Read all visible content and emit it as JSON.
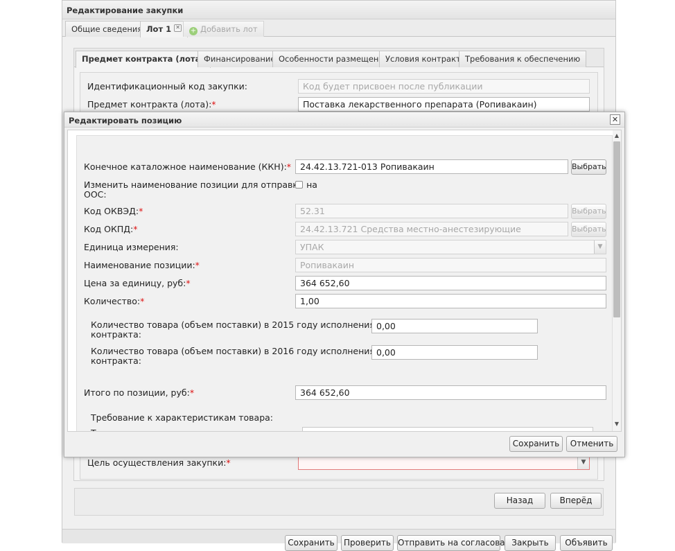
{
  "outer": {
    "title": "Редактирование закупки",
    "tabs": [
      {
        "label": "Общие сведения"
      },
      {
        "label": "Лот 1"
      },
      {
        "label": "Добавить лот"
      }
    ],
    "inner_tabs": [
      {
        "label": "Предмет контракта (лота)"
      },
      {
        "label": "Финансирование"
      },
      {
        "label": "Особенности размещения"
      },
      {
        "label": "Условия контракта"
      },
      {
        "label": "Требования к обеспечению"
      }
    ],
    "fields": {
      "id_code_label": "Идентификационный код закупки:",
      "id_code_value": "Код будет присвоен после публикации",
      "subject_label": "Предмет контракта (лота):",
      "subject_value": "Поставка лекарственного препарата (Ропивакаин)",
      "purpose_label": "Цель осуществления закупки:",
      "purpose_value": ""
    },
    "nav_buttons": {
      "back": "Назад",
      "forward": "Вперёд"
    },
    "bottom_buttons": [
      "Сохранить",
      "Проверить",
      "Отправить на согласование",
      "Закрыть",
      "Объявить"
    ]
  },
  "modal": {
    "title": "Редактировать позицию",
    "close_icon": "close-icon",
    "fields": {
      "kkn_label": "Конечное каталожное наименование (ККН):",
      "kkn_value": "24.42.13.721-013 Ропивакаин",
      "kkn_button": "Выбрать",
      "rename_label_line1": "Изменить наименование позиции для отправки на",
      "rename_label_line2": "ООС:",
      "okved_label": "Код ОКВЭД:",
      "okved_value": "52.31",
      "okved_button": "Выбрать",
      "okpd_label": "Код ОКПД:",
      "okpd_value": "24.42.13.721 Средства местно-анестезирующие",
      "okpd_button": "Выбрать",
      "unit_label": "Единица измерения:",
      "unit_value": "УПАК",
      "name_label": "Наименование позиции:",
      "name_value": "Ропивакаин",
      "price_label": "Цена за единицу, руб:",
      "price_value": "364 652,60",
      "qty_label": "Количество:",
      "qty_value": "1,00",
      "qty2015_line1": "Количество товара (объем поставки) в 2015 году исполнения",
      "qty2015_line2": "контракта:",
      "qty2015_value": "0,00",
      "qty2016_line1": "Количество товара (объем поставки) в 2016 году исполнения",
      "qty2016_line2": "контракта:",
      "qty2016_value": "0,00",
      "total_label": "Итого по позиции, руб:",
      "total_value": "364 652,60",
      "requirements_label": "Требование к характеристикам товара:",
      "cut_label": "Т"
    },
    "buttons": {
      "save": "Сохранить",
      "cancel": "Отменить"
    }
  }
}
